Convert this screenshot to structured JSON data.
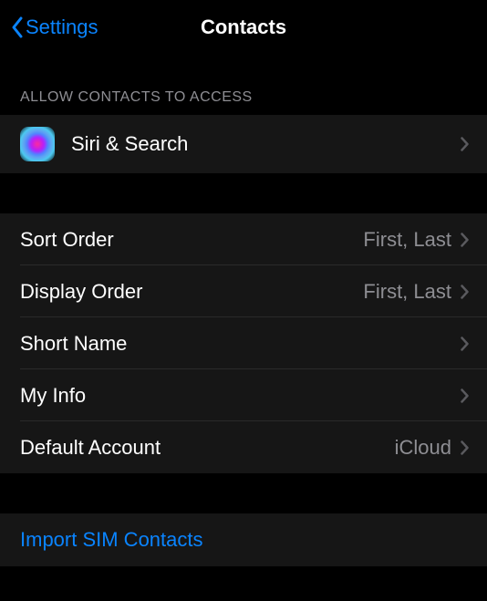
{
  "header": {
    "back_label": "Settings",
    "title": "Contacts"
  },
  "section1": {
    "header": "Allow Contacts to Access",
    "siri_label": "Siri & Search"
  },
  "settings": [
    {
      "label": "Sort Order",
      "value": "First, Last"
    },
    {
      "label": "Display Order",
      "value": "First, Last"
    },
    {
      "label": "Short Name",
      "value": ""
    },
    {
      "label": "My Info",
      "value": ""
    },
    {
      "label": "Default Account",
      "value": "iCloud"
    }
  ],
  "action": {
    "import_label": "Import SIM Contacts"
  }
}
